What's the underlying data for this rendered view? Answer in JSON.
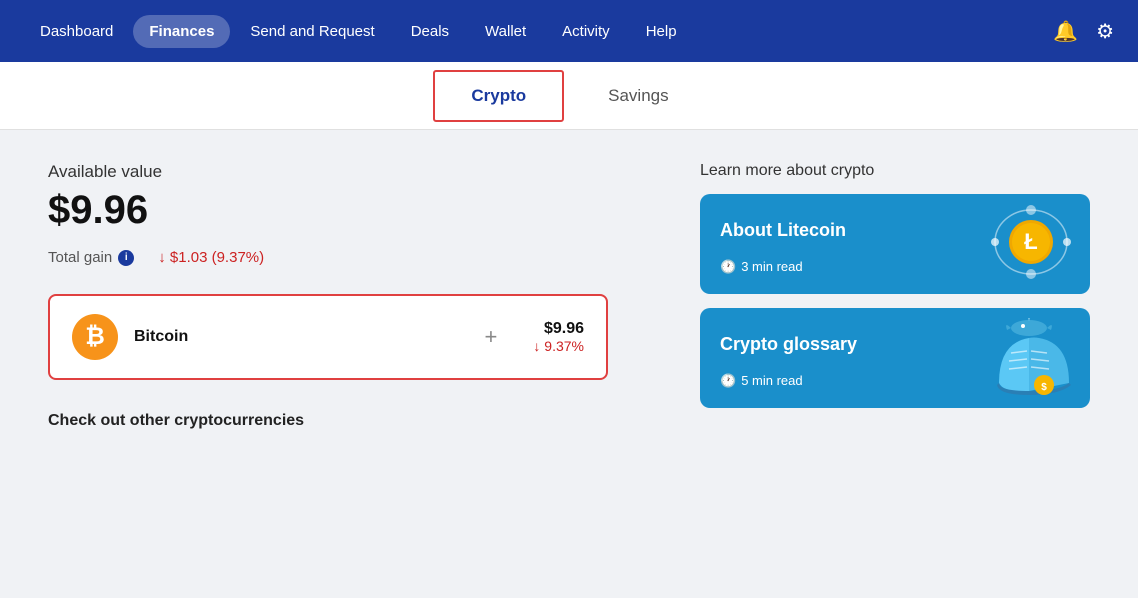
{
  "navbar": {
    "items": [
      {
        "label": "Dashboard",
        "active": false
      },
      {
        "label": "Finances",
        "active": true
      },
      {
        "label": "Send and Request",
        "active": false
      },
      {
        "label": "Deals",
        "active": false
      },
      {
        "label": "Wallet",
        "active": false
      },
      {
        "label": "Activity",
        "active": false
      },
      {
        "label": "Help",
        "active": false
      }
    ],
    "bell_icon": "🔔",
    "gear_icon": "⚙"
  },
  "tabs": [
    {
      "label": "Crypto",
      "active": true
    },
    {
      "label": "Savings",
      "active": false
    }
  ],
  "main": {
    "available_label": "Available value",
    "available_value": "$9.96",
    "total_gain_label": "Total gain",
    "total_gain_value": "↓ $1.03 (9.37%)",
    "crypto_card": {
      "name": "Bitcoin",
      "price": "$9.96",
      "change": "↓ 9.37%"
    },
    "check_other_label": "Check out other cryptocurrencies"
  },
  "learn": {
    "title": "Learn more about crypto",
    "cards": [
      {
        "title": "About Litecoin",
        "time": "3 min read"
      },
      {
        "title": "Crypto glossary",
        "time": "5 min read"
      }
    ]
  }
}
